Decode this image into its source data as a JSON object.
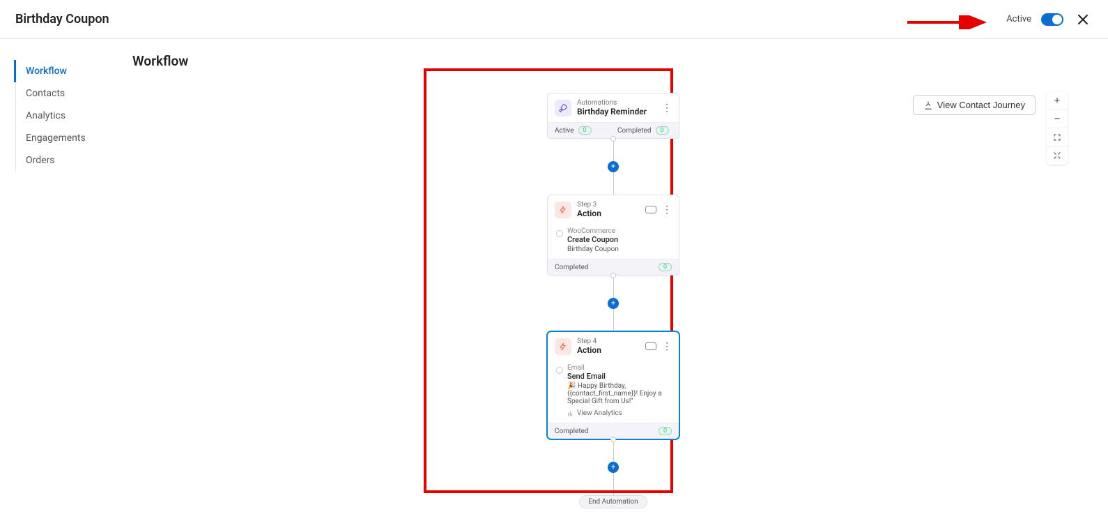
{
  "header": {
    "title": "Birthday Coupon",
    "active_label": "Active",
    "toggle_on": true
  },
  "sidebar": {
    "items": [
      {
        "label": "Workflow"
      },
      {
        "label": "Contacts"
      },
      {
        "label": "Analytics"
      },
      {
        "label": "Engagements"
      },
      {
        "label": "Orders"
      }
    ],
    "selected": 0
  },
  "content": {
    "heading": "Workflow",
    "contact_journey_btn": "View Contact Journey"
  },
  "flow": {
    "steps": [
      {
        "kind": "trigger",
        "sup": "Automations",
        "title": "Birthday Reminder",
        "footer": [
          {
            "label": "Active",
            "count": "0"
          },
          {
            "label": "Completed",
            "count": "0"
          }
        ]
      },
      {
        "kind": "action",
        "sup": "Step 3",
        "title": "Action",
        "seg_label": "WooCommerce",
        "seg_value": "Create Coupon",
        "seg_desc": "Birthday Coupon",
        "footer": [
          {
            "label": "Completed",
            "count": "0"
          }
        ]
      },
      {
        "kind": "action",
        "focused": true,
        "sup": "Step 4",
        "title": "Action",
        "seg_label": "Email",
        "seg_value": "Send Email",
        "seg_desc": "🎉 Happy Birthday,{{contact_first_name}}! Enjoy a Special Gift from Us!\"",
        "analytics": "View Analytics",
        "footer": [
          {
            "label": "Completed",
            "count": "0"
          }
        ]
      }
    ],
    "end_label": "End Automation"
  }
}
